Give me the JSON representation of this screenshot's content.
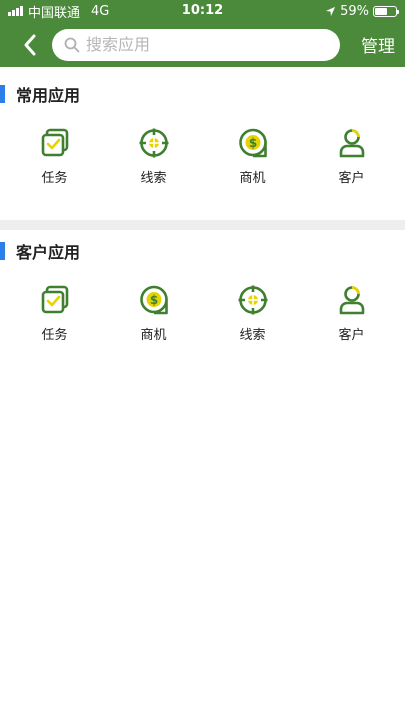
{
  "status_bar": {
    "carrier": "中国联通",
    "network": "4G",
    "time": "10:12",
    "battery": "59%",
    "battery_level": 0.59
  },
  "nav": {
    "search_placeholder": "搜索应用",
    "manage_label": "管理"
  },
  "sections": [
    {
      "title": "常用应用",
      "apps": [
        {
          "label": "任务",
          "icon": "task-icon"
        },
        {
          "label": "线索",
          "icon": "lead-icon"
        },
        {
          "label": "商机",
          "icon": "opportunity-icon"
        },
        {
          "label": "客户",
          "icon": "customer-icon"
        }
      ]
    },
    {
      "title": "客户应用",
      "apps": [
        {
          "label": "任务",
          "icon": "task-icon"
        },
        {
          "label": "商机",
          "icon": "opportunity-icon"
        },
        {
          "label": "线索",
          "icon": "lead-icon"
        },
        {
          "label": "客户",
          "icon": "customer-icon"
        }
      ]
    }
  ],
  "colors": {
    "brand_green": "#4a8a3a",
    "icon_green": "#3f7f2f",
    "icon_yellow": "#e6d400",
    "accent_blue": "#2c7fe8"
  }
}
